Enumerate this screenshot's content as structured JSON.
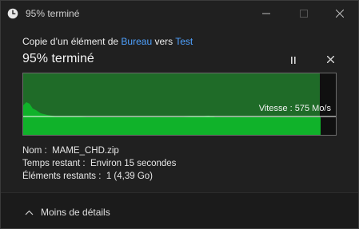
{
  "window": {
    "title": "95% terminé",
    "icons": {
      "app": "clock-icon",
      "minimize": "minimize-icon",
      "maximize": "maximize-icon",
      "close": "close-icon"
    }
  },
  "copy": {
    "prefix": "Copie d’un élément de ",
    "source": "Bureau",
    "middle": " vers ",
    "destination": "Test"
  },
  "progress": {
    "heading": "95% terminé",
    "percent": 95,
    "pause_icon": "pause-icon",
    "cancel_icon": "close-icon"
  },
  "graph": {
    "speed_label": "Vitesse : 575 Mo/s",
    "colors": {
      "fill": "#10b22a",
      "completed_region": "#1f6b28",
      "line": "#ffffff",
      "background": "#101010"
    }
  },
  "details": {
    "name_label": "Nom :",
    "name_value": "MAME_CHD.zip",
    "time_label": "Temps restant :",
    "time_value": "Environ 15 secondes",
    "items_label": "Éléments restants :",
    "items_value": "1 (4,39 Go)"
  },
  "footer": {
    "less_details": "Moins de détails",
    "chevron_icon": "chevron-up-icon"
  }
}
